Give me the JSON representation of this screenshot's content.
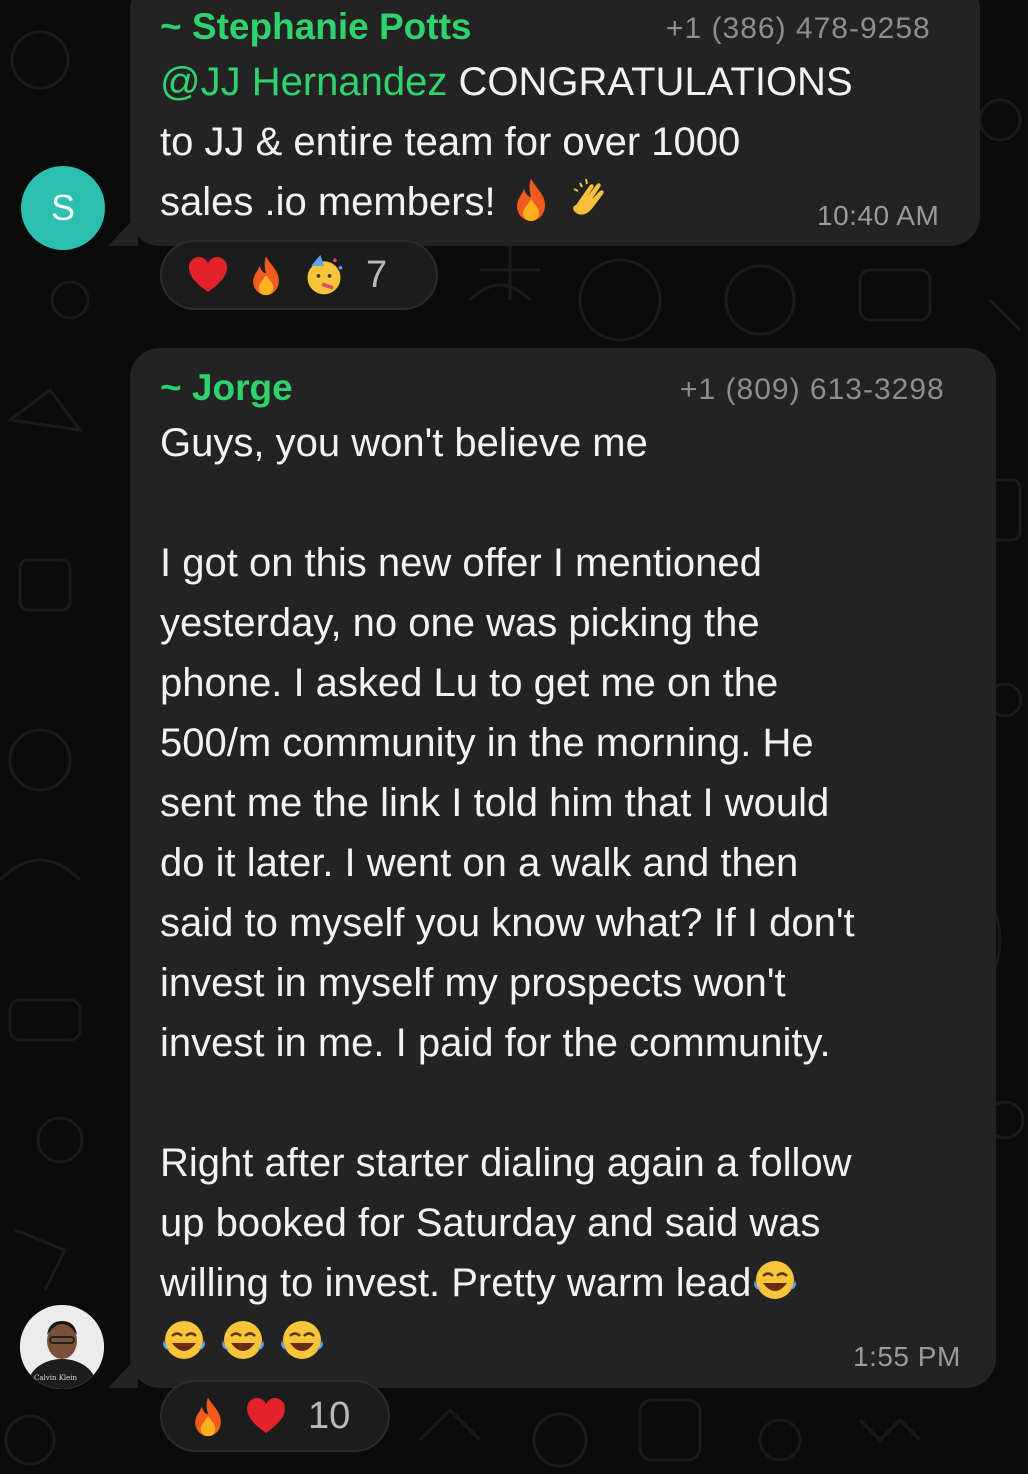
{
  "messages": [
    {
      "sender": "~ Stephanie Potts",
      "phone": "+1 (386) 478-9258",
      "avatar_letter": "S",
      "mention": "@JJ Hernandez",
      "text_line1_after_mention": " CONGRATULATIONS",
      "text_line2": "to JJ & entire team for over 1000",
      "text_line3": "sales .io members! ",
      "time": "10:40 AM",
      "reactions": {
        "emojis": [
          "heart-emoji",
          "fire-emoji",
          "party-face-emoji"
        ],
        "count": "7"
      }
    },
    {
      "sender": "~ Jorge",
      "phone": "+1 (809) 613-3298",
      "lines": [
        "Guys, you won't believe me",
        "",
        "I got on this new offer I mentioned",
        "yesterday, no one was picking the",
        "phone. I asked Lu to get me on the",
        "500/m community in the morning. He",
        "sent me the link I told him that I would",
        "do it later. I went on a walk and then",
        "said to myself you know what? If I don't",
        "invest in myself my prospects won't",
        "invest in me. I paid for the community.",
        "",
        "Right after starter dialing again a follow",
        "up booked for Saturday and said was",
        "willing to invest. Pretty warm lead"
      ],
      "time": "1:55 PM",
      "avatar_shirt_text": "Calvin Klein",
      "reactions": {
        "emojis": [
          "fire-emoji",
          "heart-emoji"
        ],
        "count": "10"
      }
    }
  ],
  "colors": {
    "background": "#0b0b0b",
    "bubble": "#232323",
    "accent_green": "#2fd36e",
    "avatar_teal": "#2bbfb0"
  }
}
